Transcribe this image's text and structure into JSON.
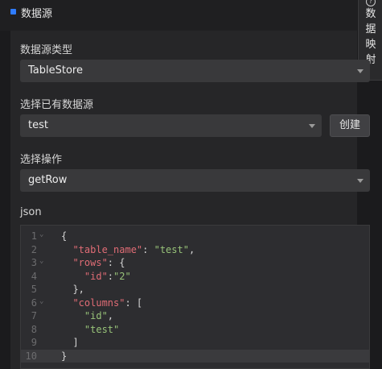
{
  "header": {
    "title": "数据源"
  },
  "side_tab": {
    "text": "数据映射"
  },
  "datasource_type": {
    "label": "数据源类型",
    "value": "TableStore"
  },
  "existing_source": {
    "label": "选择已有数据源",
    "value": "test",
    "create_label": "创建"
  },
  "operation": {
    "label": "选择操作",
    "value": "getRow"
  },
  "json_section": {
    "label": "json",
    "lines": [
      {
        "n": "1",
        "fold": true,
        "parts": [
          {
            "t": "{",
            "c": "p"
          }
        ]
      },
      {
        "n": "2",
        "fold": false,
        "parts": [
          {
            "t": "  \"table_name\"",
            "c": "k"
          },
          {
            "t": ": ",
            "c": "p"
          },
          {
            "t": "\"test\"",
            "c": "s"
          },
          {
            "t": ",",
            "c": "p"
          }
        ]
      },
      {
        "n": "3",
        "fold": true,
        "parts": [
          {
            "t": "  \"rows\"",
            "c": "k"
          },
          {
            "t": ": {",
            "c": "p"
          }
        ]
      },
      {
        "n": "4",
        "fold": false,
        "parts": [
          {
            "t": "    \"id\"",
            "c": "k"
          },
          {
            "t": ":",
            "c": "p"
          },
          {
            "t": "\"2\"",
            "c": "s"
          }
        ]
      },
      {
        "n": "5",
        "fold": false,
        "parts": [
          {
            "t": "  },",
            "c": "p"
          }
        ]
      },
      {
        "n": "6",
        "fold": true,
        "parts": [
          {
            "t": "  \"columns\"",
            "c": "k"
          },
          {
            "t": ": [",
            "c": "p"
          }
        ]
      },
      {
        "n": "7",
        "fold": false,
        "parts": [
          {
            "t": "    \"id\"",
            "c": "s"
          },
          {
            "t": ",",
            "c": "p"
          }
        ]
      },
      {
        "n": "8",
        "fold": false,
        "parts": [
          {
            "t": "    \"test\"",
            "c": "s"
          }
        ]
      },
      {
        "n": "9",
        "fold": false,
        "parts": [
          {
            "t": "  ]",
            "c": "p"
          }
        ]
      },
      {
        "n": "10",
        "fold": false,
        "active": true,
        "parts": [
          {
            "t": "}",
            "c": "p"
          }
        ]
      }
    ]
  },
  "colors": {
    "accent": "#2f7cff",
    "json_key": "#e06c75",
    "json_string": "#98c379"
  }
}
